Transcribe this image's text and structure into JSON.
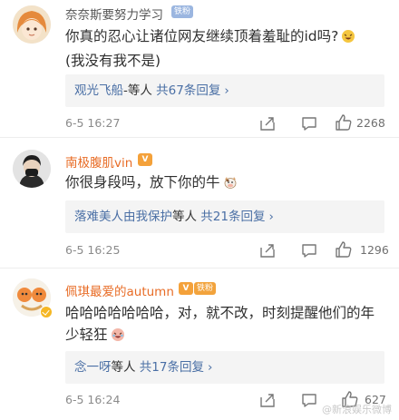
{
  "comments": [
    {
      "username": "奈奈斯要努力学习",
      "badge": "铁粉",
      "text_line1": "你真的忍心让诸位网友继续顶着羞耻的id吗?",
      "text_line2": "(我没有我不是)",
      "reply_users": "观光飞船",
      "reply_sep": "-等人",
      "reply_count": "共67条回复",
      "time": "6-5 16:27",
      "likes": "2268"
    },
    {
      "username": "南极腹肌vin",
      "text_line1": "你很身段吗，放下你的牛",
      "reply_users": "落难美人由我保护",
      "reply_sep": "等人",
      "reply_count": "共21条回复",
      "time": "6-5 16:25",
      "likes": "1296"
    },
    {
      "username": "佩琪最爱的autumn",
      "badge": "铁粉",
      "text_line1": "哈哈哈哈哈哈哈，对，就不改，时刻提醒他们的年",
      "text_line2": "少轻狂",
      "reply_users": "念一呀",
      "reply_sep": "等人",
      "reply_count": "共17条回复",
      "time": "6-5 16:24",
      "likes": "627"
    }
  ],
  "watermark": "@新浪娱乐微博",
  "icons": {
    "share": "share-icon",
    "comment": "comment-icon",
    "like": "thumbs-up-icon",
    "vip": "vip-crown-icon",
    "verified": "verified-badge-icon"
  },
  "colors": {
    "link": "#4a6fa5",
    "vip_name": "#e86c26",
    "badge_fan": "#9bb6e0",
    "badge_fan_gold": "#f2a33c"
  }
}
